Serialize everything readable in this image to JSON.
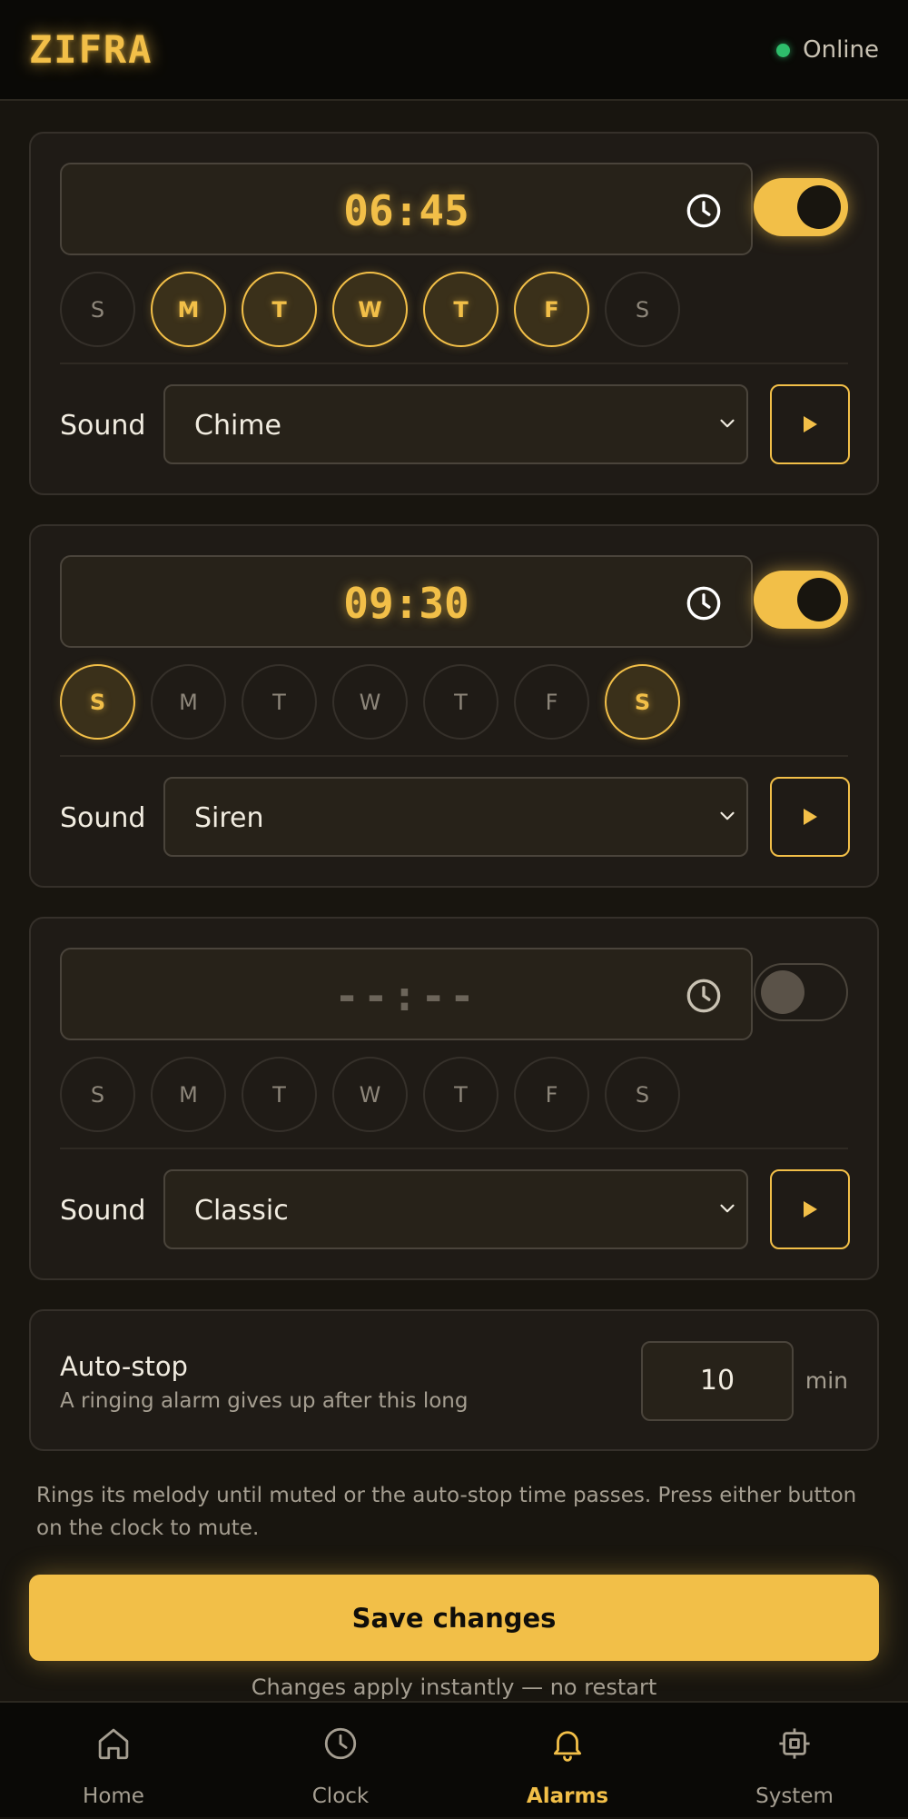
{
  "header": {
    "logo": "ZIFRA",
    "status": "Online",
    "status_color": "#2ebd6b"
  },
  "colors": {
    "accent": "#f2bf48",
    "background": "#18150f",
    "card": "#1f1b16"
  },
  "alarms": [
    {
      "time": "06:45",
      "enabled": true,
      "days": [
        {
          "label": "S",
          "on": false
        },
        {
          "label": "M",
          "on": true
        },
        {
          "label": "T",
          "on": true
        },
        {
          "label": "W",
          "on": true
        },
        {
          "label": "T",
          "on": true
        },
        {
          "label": "F",
          "on": true
        },
        {
          "label": "S",
          "on": false
        }
      ],
      "sound_label": "Sound",
      "sound": "Chime"
    },
    {
      "time": "09:30",
      "enabled": true,
      "days": [
        {
          "label": "S",
          "on": true
        },
        {
          "label": "M",
          "on": false
        },
        {
          "label": "T",
          "on": false
        },
        {
          "label": "W",
          "on": false
        },
        {
          "label": "T",
          "on": false
        },
        {
          "label": "F",
          "on": false
        },
        {
          "label": "S",
          "on": true
        }
      ],
      "sound_label": "Sound",
      "sound": "Siren"
    },
    {
      "time": "--:--",
      "enabled": false,
      "days": [
        {
          "label": "S",
          "on": false
        },
        {
          "label": "M",
          "on": false
        },
        {
          "label": "T",
          "on": false
        },
        {
          "label": "W",
          "on": false
        },
        {
          "label": "T",
          "on": false
        },
        {
          "label": "F",
          "on": false
        },
        {
          "label": "S",
          "on": false
        }
      ],
      "sound_label": "Sound",
      "sound": "Classic"
    }
  ],
  "autostop": {
    "title": "Auto-stop",
    "subtitle": "A ringing alarm gives up after this long",
    "value": "10",
    "unit": "min"
  },
  "note": "Rings its melody until muted or the auto-stop time passes. Press either button on the clock to mute.",
  "save_label": "Save changes",
  "hint": "Changes apply instantly — no restart",
  "nav": [
    {
      "label": "Home",
      "icon": "home-icon",
      "active": false
    },
    {
      "label": "Clock",
      "icon": "clock-icon",
      "active": false
    },
    {
      "label": "Alarms",
      "icon": "bell-icon",
      "active": true
    },
    {
      "label": "System",
      "icon": "chip-icon",
      "active": false
    }
  ]
}
